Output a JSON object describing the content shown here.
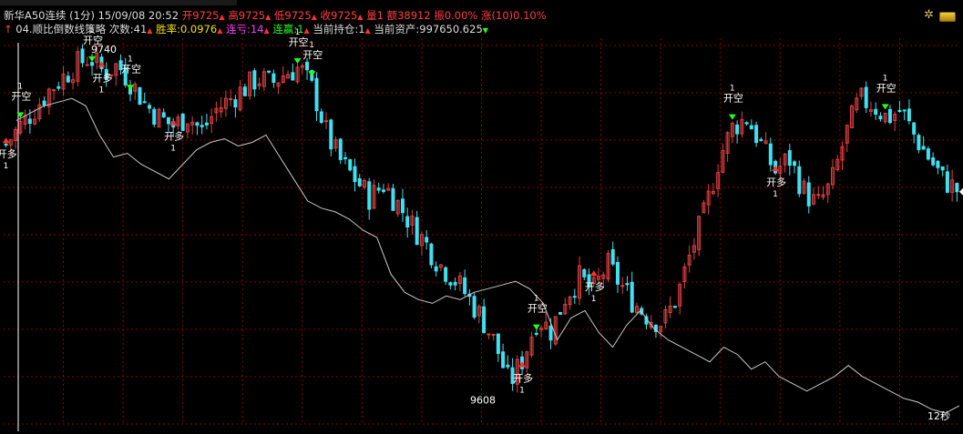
{
  "header": {
    "instrument": "新华A50连续",
    "period": "(1分)",
    "datetime": "15/09/08 20:52",
    "open": "开9725",
    "high": "高9725",
    "low": "低9725",
    "close": "收9725",
    "volume": "量1",
    "amount": "额38912",
    "amplitude": "振0.00%",
    "change": "涨(10)0.10%"
  },
  "strategy": {
    "name": "04.顺比倒数线策略",
    "trades": "次数:41",
    "win_rate": "胜率:0.0976",
    "loss_streak": "连亏:14",
    "win_streak": "连赢:1",
    "position": "当前持仓:1",
    "assets": "当前资产:997650.625"
  },
  "annotations": {
    "high_value": "9740",
    "low_value": "9608",
    "countdown": "12秒",
    "buy_label": "开多",
    "sell_label": "开空",
    "order_qty": "1"
  },
  "icons": [
    "gear-icon",
    "gold-coins-icon"
  ],
  "colors": {
    "background": "#000000",
    "grid": "#8a0000",
    "up_candle": "#e04040",
    "down_candle": "#40e0f0",
    "equity_line": "#c8c8c8",
    "buy_arrow": "#ff3030",
    "sell_arrow": "#20ff20"
  },
  "chart_data": {
    "type": "candlestick",
    "title": "新华A50连续 (1分)",
    "y_range": [
      9600,
      9745
    ],
    "grid": true,
    "price_seed": [
      9705,
      9712,
      9718,
      9725,
      9730,
      9735,
      9738,
      9732,
      9735,
      9728,
      9720,
      9715,
      9712,
      9716,
      9710,
      9718,
      9722,
      9726,
      9730,
      9728,
      9732,
      9734,
      9725,
      9708,
      9698,
      9692,
      9685,
      9690,
      9683,
      9675,
      9668,
      9660,
      9655,
      9648,
      9640,
      9630,
      9615,
      9625,
      9640,
      9635,
      9648,
      9655,
      9650,
      9660,
      9652,
      9645,
      9640,
      9638,
      9648,
      9665,
      9680,
      9700,
      9712,
      9715,
      9705,
      9695,
      9700,
      9688,
      9682,
      9690,
      9708,
      9722,
      9720,
      9715,
      9718,
      9708,
      9700,
      9692,
      9688
    ],
    "equity_curve": [
      0.82,
      0.84,
      0.86,
      0.87,
      0.88,
      0.86,
      0.78,
      0.72,
      0.73,
      0.7,
      0.68,
      0.66,
      0.7,
      0.74,
      0.76,
      0.77,
      0.75,
      0.76,
      0.78,
      0.72,
      0.66,
      0.6,
      0.58,
      0.57,
      0.55,
      0.52,
      0.5,
      0.4,
      0.35,
      0.33,
      0.32,
      0.34,
      0.33,
      0.35,
      0.36,
      0.37,
      0.38,
      0.36,
      0.32,
      0.22,
      0.28,
      0.3,
      0.24,
      0.2,
      0.26,
      0.3,
      0.25,
      0.22,
      0.2,
      0.18,
      0.16,
      0.2,
      0.18,
      0.14,
      0.16,
      0.12,
      0.1,
      0.08,
      0.1,
      0.12,
      0.15,
      0.12,
      0.1,
      0.08,
      0.06,
      0.05,
      0.03,
      0.02,
      0.04
    ],
    "signals": [
      {
        "index": 0,
        "type": "buy"
      },
      {
        "index": 1,
        "type": "sell"
      },
      {
        "index": 6,
        "type": "sell"
      },
      {
        "index": 7,
        "type": "buy"
      },
      {
        "index": 9,
        "type": "sell"
      },
      {
        "index": 12,
        "type": "buy"
      },
      {
        "index": 21,
        "type": "sell"
      },
      {
        "index": 22,
        "type": "sell"
      },
      {
        "index": 37,
        "type": "buy"
      },
      {
        "index": 38,
        "type": "sell"
      },
      {
        "index": 42,
        "type": "buy"
      },
      {
        "index": 52,
        "type": "sell"
      },
      {
        "index": 55,
        "type": "buy"
      },
      {
        "index": 63,
        "type": "sell"
      }
    ]
  }
}
